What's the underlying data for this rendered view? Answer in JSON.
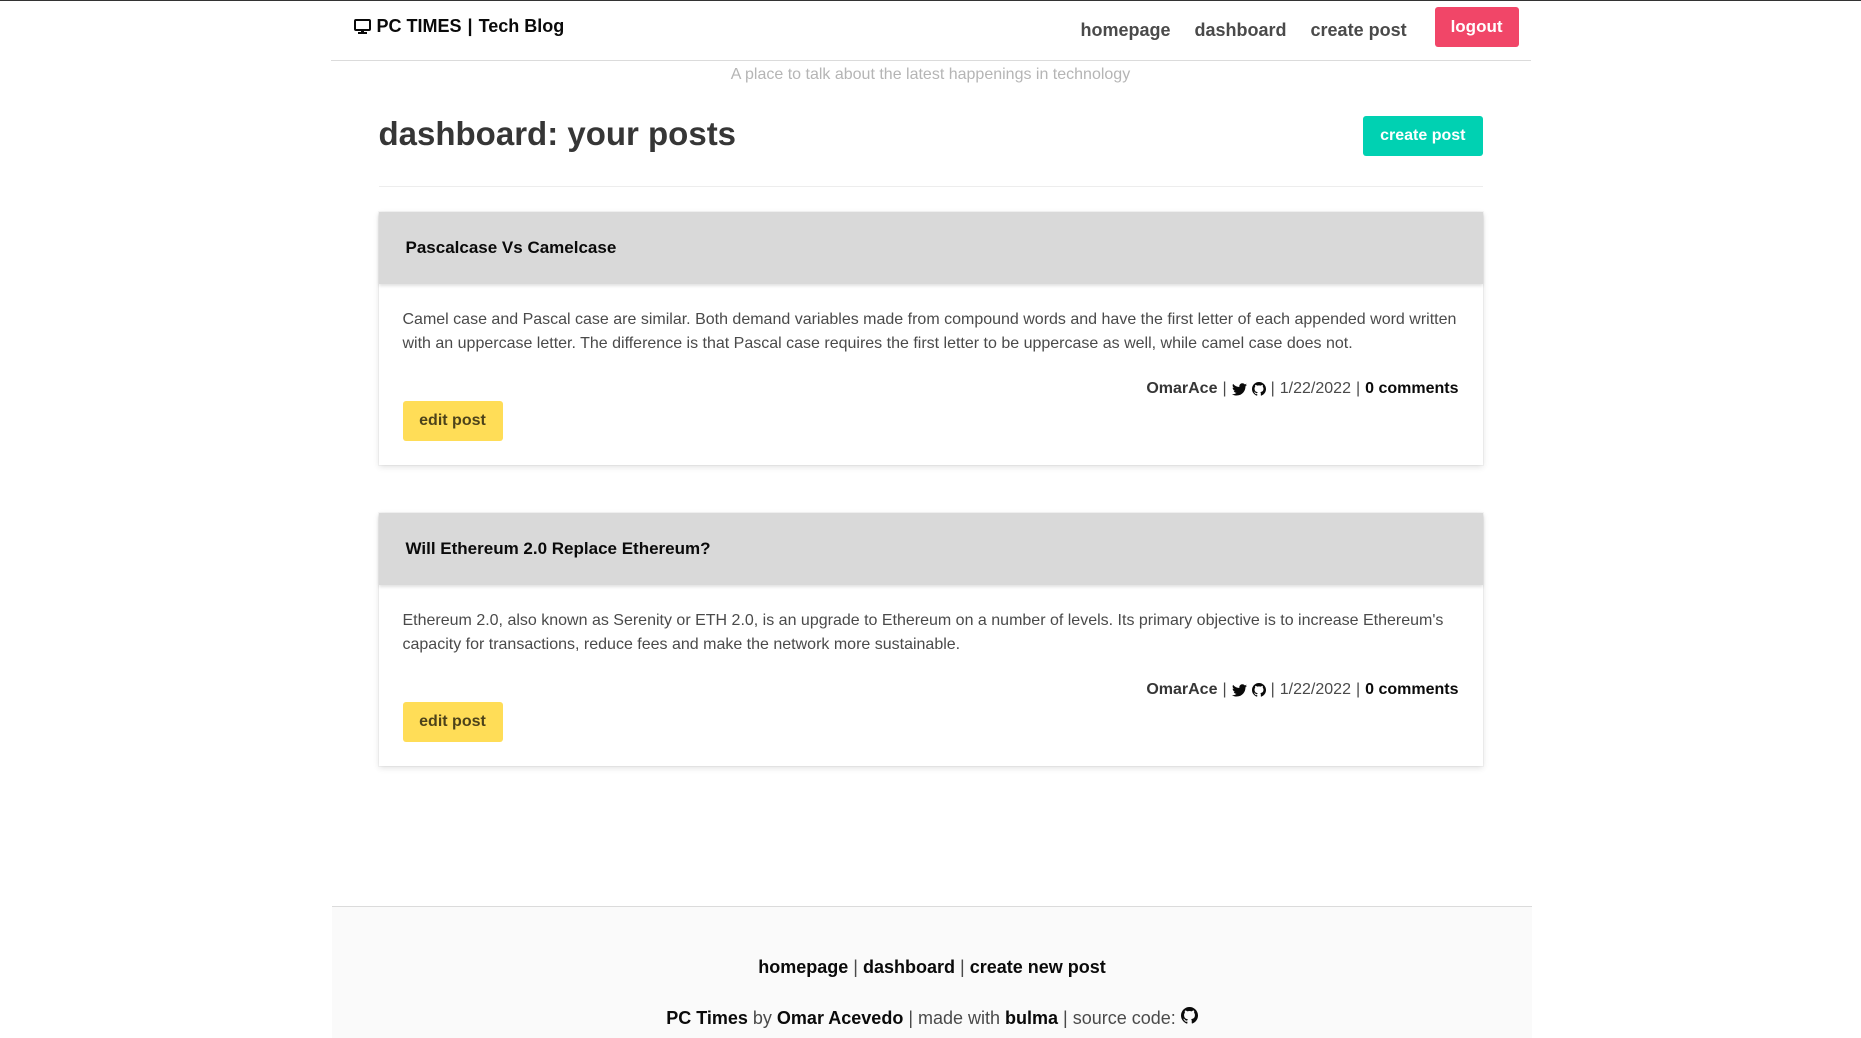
{
  "nav": {
    "brand_name": "PC TIMES",
    "brand_sep": "|",
    "brand_sub": "Tech Blog",
    "brand_icon": "monitor-icon",
    "links": [
      "homepage",
      "dashboard",
      "create post"
    ],
    "logout_label": "logout"
  },
  "subtitle": "A place to talk about the latest happenings in technology",
  "dashboard": {
    "title": "dashboard: your posts",
    "create_label": "create post"
  },
  "posts": [
    {
      "title": "Pascalcase Vs Camelcase",
      "body": "Camel case and Pascal case are similar. Both demand variables made from compound words and have the first letter of each appended word written with an uppercase letter. The difference is that Pascal case requires the first letter to be uppercase as well, while camel case does not.",
      "author": "OmarAce",
      "date": "1/22/2022",
      "comments": "0 comments",
      "edit_label": "edit post"
    },
    {
      "title": "Will Ethereum 2.0 Replace Ethereum?",
      "body": "Ethereum 2.0, also known as Serenity or ETH 2.0, is an upgrade to Ethereum on a number of levels. Its primary objective is to increase Ethereum's capacity for transactions, reduce fees and make the network more sustainable.",
      "author": "OmarAce",
      "date": "1/22/2022",
      "comments": "0 comments",
      "edit_label": "edit post"
    }
  ],
  "footer": {
    "links": [
      "homepage",
      "dashboard",
      "create new post"
    ],
    "sep": "|",
    "site_name": "PC Times",
    "by": "by",
    "author": "Omar Acevedo",
    "made_with": "| made with",
    "framework": "bulma",
    "source": "| source code:"
  },
  "colors": {
    "logout": "#f14668",
    "create": "#00d1b2",
    "edit": "#ffdd57",
    "card_header": "#d9d9d9"
  },
  "icons": [
    "monitor-icon",
    "twitter-icon",
    "github-icon"
  ]
}
